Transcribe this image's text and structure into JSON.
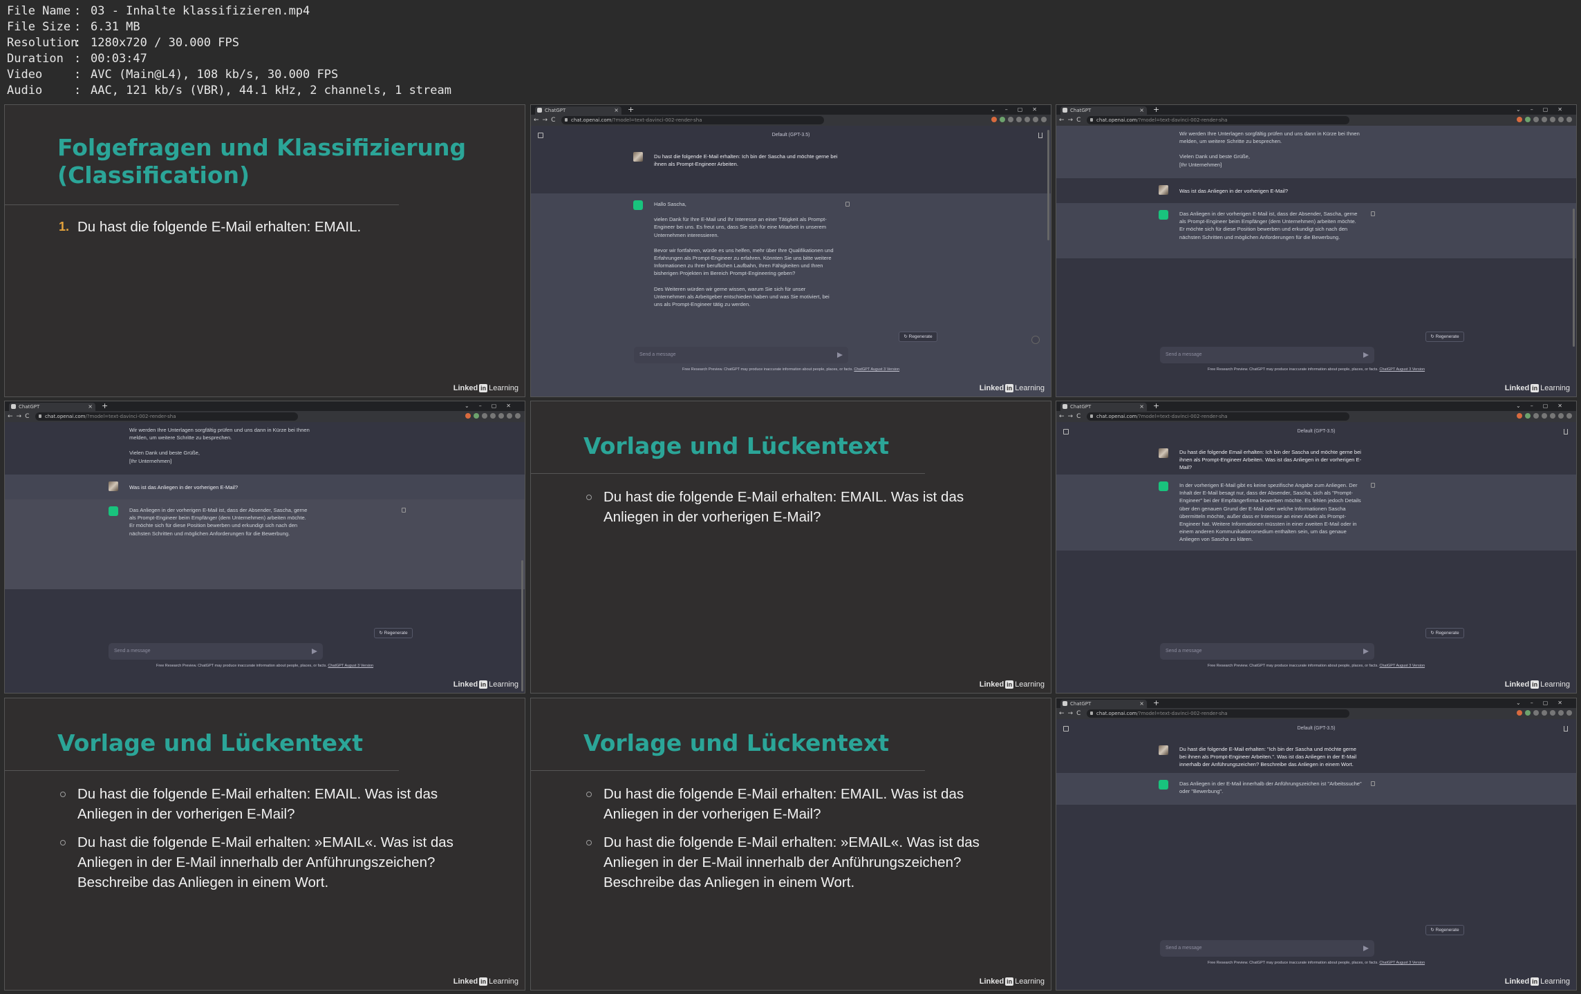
{
  "file_info": [
    {
      "key": "File Name",
      "value": "03 - Inhalte klassifizieren.mp4"
    },
    {
      "key": "File Size",
      "value": "6.31 MB"
    },
    {
      "key": "Resolution",
      "value": "1280x720 / 30.000 FPS"
    },
    {
      "key": "Duration",
      "value": "00:03:47"
    },
    {
      "key": "Video",
      "value": "AVC (Main@L4), 108 kb/s, 30.000 FPS"
    },
    {
      "key": "Audio",
      "value": "AAC, 121 kb/s (VBR), 44.1 kHz, 2 channels, 1 stream"
    }
  ],
  "branding": {
    "brand_a": "Linked",
    "brand_in": "in",
    "brand_b": "Learning"
  },
  "browser": {
    "tab_title": "ChatGPT",
    "tab_close": "×",
    "new_tab": "+",
    "window_controls": "⌄–▢✕",
    "nav": "←→C",
    "url_host": "chat.openai.com",
    "url_path": "/?model=text-davinci-002-render-sha",
    "model_label": "Default (GPT-3.5)",
    "input_placeholder": "Send a message",
    "regenerate_label": "↻ Regenerate",
    "footer_text": "Free Research Preview. ChatGPT may produce inaccurate information about people, places, or facts.",
    "footer_link": "ChatGPT August 3 Version"
  },
  "slide1": {
    "title_l1": "Folgefragen und Klassifizierung",
    "title_l2": "(Classification)",
    "item1_num": "1.",
    "item1": "Du hast die folgende E-Mail erhalten: EMAIL."
  },
  "slide_vorlage": {
    "title": "Vorlage und Lückentext",
    "item1": "Du hast die folgende E-Mail erhalten: EMAIL. Was ist das Anliegen in der vorherigen E-Mail?",
    "item2": "Du hast die folgende E-Mail erhalten: »EMAIL«. Was ist das Anliegen in der E-Mail innerhalb der Anführungszeichen? Beschreibe das Anliegen in einem Wort."
  },
  "chat_a": {
    "user_msg": "Du hast die folgende E-Mail erhalten: Ich bin der Sascha und möchte gerne bei ihnen als Prompt-Engineer Arbeiten.",
    "bot_p1": "Hallo Sascha,",
    "bot_p2": "vielen Dank für Ihre E-Mail und Ihr Interesse an einer Tätigkeit als Prompt-Engineer bei uns. Es freut uns, dass Sie sich für eine Mitarbeit in unserem Unternehmen interessieren.",
    "bot_p3": "Bevor wir fortfahren, würde es uns helfen, mehr über Ihre Qualifikationen und Erfahrungen als Prompt-Engineer zu erfahren. Könnten Sie uns bitte weitere Informationen zu Ihrer beruflichen Laufbahn, Ihren Fähigkeiten und Ihren bisherigen Projekten im Bereich Prompt-Engineering geben?",
    "bot_p4": "Des Weiteren würden wir gerne wissen, warum Sie sich für unser Unternehmen als Arbeitgeber entschieden haben und was Sie motiviert, bei uns als Prompt-Engineer tätig zu werden."
  },
  "chat_b": {
    "bot_tail_p1": "Wir werden Ihre Unterlagen sorgfältig prüfen und uns dann in Kürze bei Ihnen melden, um weitere Schritte zu besprechen.",
    "bot_tail_p2": "Vielen Dank und beste Grüße,",
    "bot_tail_p3": "[Ihr Unternehmen]",
    "user_msg": "Was ist das Anliegen in der vorherigen E-Mail?",
    "bot_msg": "Das Anliegen in der vorherigen E-Mail ist, dass der Absender, Sascha, gerne als Prompt-Engineer beim Empfänger (dem Unternehmen) arbeiten möchte. Er möchte sich für diese Position bewerben und erkundigt sich nach den nächsten Schritten und möglichen Anforderungen für die Bewerbung."
  },
  "chat_c": {
    "user_msg": "Du hast die folgende Email erhalten: Ich bin der Sascha und möchte gerne bei ihnen als Prompt-Engineer Arbeiten. Was ist das Anliegen in der vorherigen E-Mail?",
    "bot_msg": "In der vorherigen E-Mail gibt es keine spezifische Angabe zum Anliegen. Der Inhalt der E-Mail besagt nur, dass der Absender, Sascha, sich als \"Prompt-Engineer\" bei der Empfängerfirma bewerben möchte. Es fehlen jedoch Details über den genauen Grund der E-Mail oder welche Informationen Sascha übermitteln möchte, außer dass er Interesse an einer Arbeit als Prompt-Engineer hat. Weitere Informationen müssten in einer zweiten E-Mail oder in einem anderen Kommunikationsmedium enthalten sein, um das genaue Anliegen von Sascha zu klären."
  },
  "chat_d": {
    "user_msg": "Du hast die folgende E-Mail erhalten: \"Ich bin der Sascha und möchte gerne bei ihnen als Prompt-Engineer Arbeiten.\". Was ist das Anliegen in der E-Mail innerhalb der Anführungszeichen? Beschreibe das Anliegen in einem Wort.",
    "bot_msg": "Das Anliegen in der E-Mail innerhalb der Anführungszeichen ist \"Arbeitssuche\" oder \"Bewerbung\"."
  }
}
